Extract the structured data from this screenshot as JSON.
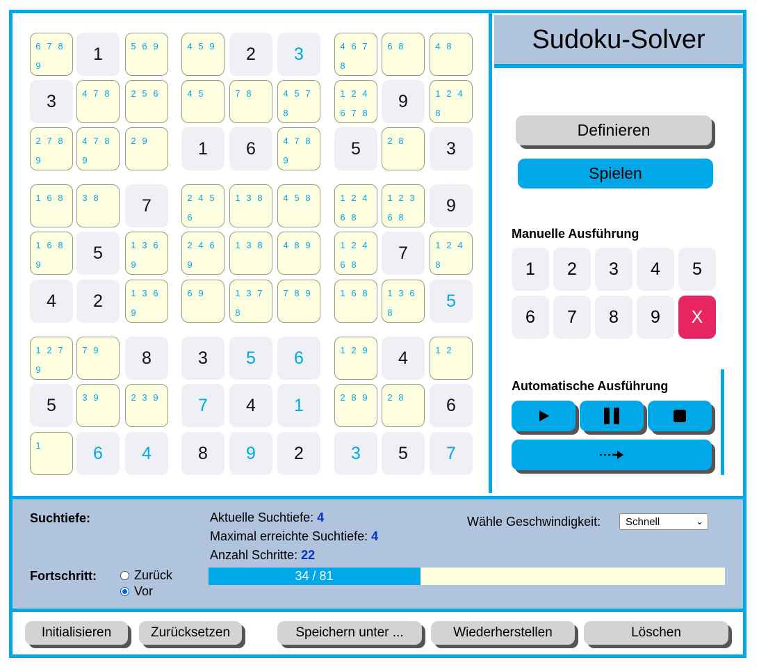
{
  "app": {
    "title": "Sudoku-Solver"
  },
  "grid": [
    [
      "6 7 8 9",
      "1",
      "5 6 9",
      "4 5 9",
      "2",
      "s3",
      "4 6 7 8",
      "6 8",
      "4 8"
    ],
    [
      "3",
      "4 7 8",
      "2 5 6",
      "4 5",
      "7 8",
      "4 5 7 8",
      "1 2 4 6 7 8",
      "9",
      "1 2 4 8"
    ],
    [
      "2 7 8 9",
      "4 7 8 9",
      "2 9",
      "1",
      "6",
      "4 7 8 9",
      "5",
      "2 8",
      "3"
    ],
    [
      "1 6 8",
      "3 8",
      "7",
      "2 4 5 6",
      "1 3 8",
      "4 5 8",
      "1 2 4 6 8",
      "1 2 3 6 8",
      "9"
    ],
    [
      "1 6 8 9",
      "5",
      "1 3 6 9",
      "2 4 6 9",
      "1 3 8",
      "4 8 9",
      "1 2 4 6 8",
      "7",
      "1 2 4 8"
    ],
    [
      "4",
      "2",
      "1 3 6 9",
      "6 9",
      "1 3 7 8",
      "7 8 9",
      "1 6 8",
      "1 3 6 8",
      "s5"
    ],
    [
      "1 2 7 9",
      "7 9",
      "8",
      "3",
      "s5",
      "s6",
      "1 2 9",
      "4",
      "1 2"
    ],
    [
      "5",
      "3 9",
      "2 3 9",
      "s7",
      "4",
      "s1",
      "2 8 9",
      "2 8",
      "6"
    ],
    [
      "1",
      "s6",
      "s4",
      "8",
      "s9",
      "2",
      "s3",
      "5",
      "s7"
    ]
  ],
  "mode": {
    "define_label": "Definieren",
    "play_label": "Spielen"
  },
  "manual": {
    "title": "Manuelle Ausführung",
    "buttons": [
      "1",
      "2",
      "3",
      "4",
      "5",
      "6",
      "7",
      "8",
      "9",
      "X"
    ]
  },
  "auto": {
    "title": "Automatische Ausführung",
    "icons": [
      "play-icon",
      "pause-icon",
      "stop-icon",
      "step-icon"
    ]
  },
  "status": {
    "search_depth_label": "Suchtiefe:",
    "current_depth_label": "Aktuelle Suchtiefe:",
    "current_depth": "4",
    "max_depth_label": "Maximal erreichte Suchtiefe:",
    "max_depth": "4",
    "steps_label": "Anzahl Schritte:",
    "steps": "22",
    "speed_label": "Wähle Geschwindigkeit:",
    "speed_value": "Schnell",
    "progress_label": "Fortschritt:",
    "direction_back": "Zurück",
    "direction_forward": "Vor",
    "selected_direction": "Vor",
    "progress_text": "34 / 81",
    "progress_fraction": 0.41
  },
  "footer": {
    "initialize": "Initialisieren",
    "reset": "Zurücksetzen",
    "save_as": "Speichern unter ...",
    "restore": "Wiederherstellen",
    "delete": "Löschen"
  },
  "colors": {
    "accent": "#00a8e8",
    "panel": "#b0c4de",
    "candidate_bg": "#fdfde0",
    "clear_button": "#e92463",
    "depth_numbers": "#0033cc"
  }
}
